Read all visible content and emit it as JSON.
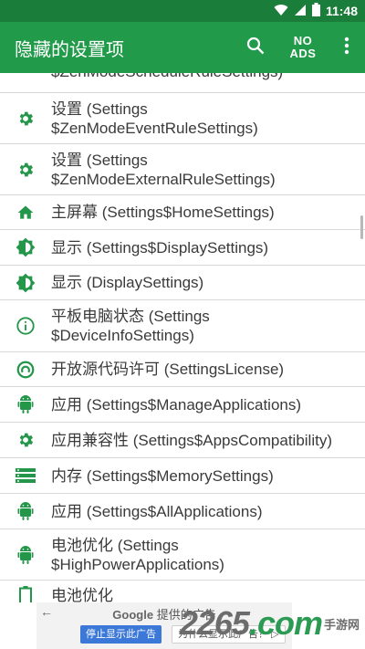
{
  "status_bar": {
    "time": "11:48"
  },
  "app_bar": {
    "title": "隐藏的设置项",
    "no_ads_line1": "NO",
    "no_ads_line2": "ADS"
  },
  "items": [
    {
      "icon": "gear-icon",
      "lines": [
        "$ZenModeScheduleRuleSettings)"
      ]
    },
    {
      "icon": "gear-icon",
      "lines": [
        "设置 (Settings",
        "$ZenModeEventRuleSettings)"
      ]
    },
    {
      "icon": "gear-icon",
      "lines": [
        "设置 (Settings",
        "$ZenModeExternalRuleSettings)"
      ]
    },
    {
      "icon": "home-icon",
      "lines": [
        "主屏幕 (Settings$HomeSettings)"
      ]
    },
    {
      "icon": "brightness-icon",
      "lines": [
        "显示 (Settings$DisplaySettings)"
      ]
    },
    {
      "icon": "brightness-icon",
      "lines": [
        "显示 (DisplaySettings)"
      ]
    },
    {
      "icon": "info-icon",
      "lines": [
        "平板电脑状态 (Settings",
        "$DeviceInfoSettings)"
      ]
    },
    {
      "icon": "copyleft-icon",
      "lines": [
        "开放源代码许可 (SettingsLicense)"
      ]
    },
    {
      "icon": "android-icon",
      "lines": [
        "应用 (Settings$ManageApplications)"
      ]
    },
    {
      "icon": "gear-icon",
      "lines": [
        "应用兼容性 (Settings$AppsCompatibility)"
      ]
    },
    {
      "icon": "storage-icon",
      "lines": [
        "内存 (Settings$MemorySettings)"
      ]
    },
    {
      "icon": "android-icon",
      "lines": [
        "应用 (Settings$AllApplications)"
      ]
    },
    {
      "icon": "android-icon",
      "lines": [
        "电池优化 (Settings",
        "$HighPowerApplications)"
      ]
    },
    {
      "icon": "battery-icon",
      "lines": [
        "电池优化"
      ]
    }
  ],
  "ad": {
    "brand": "Google",
    "provided": "提供的广告",
    "stop_label": "停止显示此广告",
    "why_label": "为什么显示此广告？"
  },
  "watermark": {
    "number": "2265",
    "suffix": ".com",
    "site": "手游网"
  },
  "colors": {
    "status_bar": "#1b7d3a",
    "app_bar": "#219a4a",
    "icon": "#23964a"
  }
}
